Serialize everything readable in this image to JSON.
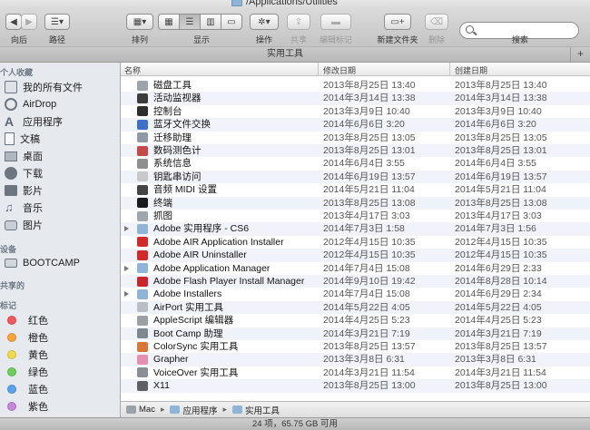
{
  "window": {
    "title": "/Applications/Utilities"
  },
  "toolbar": {
    "back_label": "向后",
    "path_label": "路径",
    "arrange_label": "排列",
    "view_label": "显示",
    "action_label": "操作",
    "share_label": "共享",
    "edit_tags_label": "编辑标记",
    "new_folder_label": "新建文件夹",
    "delete_label": "删除",
    "search_label": "搜索",
    "search_placeholder": ""
  },
  "tabbar": {
    "title": "实用工具",
    "add_glyph": "+"
  },
  "sidebar": {
    "favorites_heading": "个人收藏",
    "favorites": [
      {
        "label": "我的所有文件",
        "icon": "all-files-icon"
      },
      {
        "label": "AirDrop",
        "icon": "airdrop-icon"
      },
      {
        "label": "应用程序",
        "icon": "applications-icon"
      },
      {
        "label": "文稿",
        "icon": "documents-icon"
      },
      {
        "label": "桌面",
        "icon": "desktop-icon"
      },
      {
        "label": "下载",
        "icon": "downloads-icon"
      },
      {
        "label": "影片",
        "icon": "movies-icon"
      },
      {
        "label": "音乐",
        "icon": "music-icon"
      },
      {
        "label": "图片",
        "icon": "pictures-icon"
      }
    ],
    "devices_heading": "设备",
    "devices": [
      {
        "label": "BOOTCAMP",
        "icon": "drive-icon"
      }
    ],
    "shared_heading": "共享的",
    "tags_heading": "标记",
    "tags": [
      {
        "label": "红色",
        "color": "#f3595b"
      },
      {
        "label": "橙色",
        "color": "#f7a43c"
      },
      {
        "label": "黄色",
        "color": "#f2d94a"
      },
      {
        "label": "绿色",
        "color": "#6dce5b"
      },
      {
        "label": "蓝色",
        "color": "#5aa2f0"
      },
      {
        "label": "紫色",
        "color": "#c785dd"
      }
    ]
  },
  "list": {
    "columns": {
      "name": "名称",
      "modified": "修改日期",
      "created": "创建日期"
    },
    "rows": [
      {
        "name": "磁盘工具",
        "modified": "2013年8月25日 13:40",
        "created": "2013年8月25日 13:40",
        "folder": false,
        "color": "#9aa4ad"
      },
      {
        "name": "活动监视器",
        "modified": "2014年3月14日 13:38",
        "created": "2014年3月14日 13:38",
        "folder": false,
        "color": "#3c3c3c"
      },
      {
        "name": "控制台",
        "modified": "2013年3月9日 10:40",
        "created": "2013年3月9日 10:40",
        "folder": false,
        "color": "#2e2e2e"
      },
      {
        "name": "蓝牙文件交换",
        "modified": "2014年6月6日 3:20",
        "created": "2014年6月6日 3:20",
        "folder": false,
        "color": "#3f6fc7"
      },
      {
        "name": "迁移助理",
        "modified": "2013年8月25日 13:05",
        "created": "2013年8月25日 13:05",
        "folder": false,
        "color": "#8f9aa6"
      },
      {
        "name": "数码测色计",
        "modified": "2013年8月25日 13:01",
        "created": "2013年8月25日 13:01",
        "folder": false,
        "color": "#c44a4a"
      },
      {
        "name": "系统信息",
        "modified": "2014年6月4日 3:55",
        "created": "2014年6月4日 3:55",
        "folder": false,
        "color": "#8f8f8f"
      },
      {
        "name": "钥匙串访问",
        "modified": "2014年6月19日 13:57",
        "created": "2014年6月19日 13:57",
        "folder": false,
        "color": "#c9c9c9"
      },
      {
        "name": "音频 MIDI 设置",
        "modified": "2014年5月21日 11:04",
        "created": "2014年5月21日 11:04",
        "folder": false,
        "color": "#444444"
      },
      {
        "name": "终端",
        "modified": "2013年8月25日 13:08",
        "created": "2013年8月25日 13:08",
        "folder": false,
        "color": "#1a1a1a"
      },
      {
        "name": "抓图",
        "modified": "2013年4月17日 3:03",
        "created": "2013年4月17日 3:03",
        "folder": false,
        "color": "#9ea6ae"
      },
      {
        "name": "Adobe 实用程序 - CS6",
        "modified": "2014年7月3日 1:58",
        "created": "2014年7月3日 1:56",
        "folder": true,
        "color": "#8fb4d8"
      },
      {
        "name": "Adobe AIR Application Installer",
        "modified": "2012年4月15日 10:35",
        "created": "2012年4月15日 10:35",
        "folder": false,
        "color": "#d22a2a"
      },
      {
        "name": "Adobe AIR Uninstaller",
        "modified": "2012年4月15日 10:35",
        "created": "2012年4月15日 10:35",
        "folder": false,
        "color": "#d22a2a"
      },
      {
        "name": "Adobe Application Manager",
        "modified": "2014年7月4日 15:08",
        "created": "2014年6月29日 2:33",
        "folder": true,
        "color": "#8fb4d8"
      },
      {
        "name": "Adobe Flash Player Install Manager",
        "modified": "2014年9月10日 19:42",
        "created": "2014年8月28日 10:14",
        "folder": false,
        "color": "#c8262b"
      },
      {
        "name": "Adobe Installers",
        "modified": "2014年7月4日 15:08",
        "created": "2014年6月29日 2:34",
        "folder": true,
        "color": "#8fb4d8"
      },
      {
        "name": "AirPort 实用工具",
        "modified": "2014年5月22日 4:05",
        "created": "2014年5月22日 4:05",
        "folder": false,
        "color": "#b8bec4"
      },
      {
        "name": "AppleScript 编辑器",
        "modified": "2014年4月25日 5:23",
        "created": "2014年4月25日 5:23",
        "folder": false,
        "color": "#9aa0a6"
      },
      {
        "name": "Boot Camp 助理",
        "modified": "2014年3月21日 7:19",
        "created": "2014年3月21日 7:19",
        "folder": false,
        "color": "#7f8890"
      },
      {
        "name": "ColorSync 实用工具",
        "modified": "2013年8月25日 13:57",
        "created": "2013年8月25日 13:57",
        "folder": false,
        "color": "#d9773a"
      },
      {
        "name": "Grapher",
        "modified": "2013年3月8日 6:31",
        "created": "2013年3月8日 6:31",
        "folder": false,
        "color": "#e58fb3"
      },
      {
        "name": "VoiceOver 实用工具",
        "modified": "2014年3月21日 11:54",
        "created": "2014年3月21日 11:54",
        "folder": false,
        "color": "#8a8f95"
      },
      {
        "name": "X11",
        "modified": "2013年8月25日 13:00",
        "created": "2013年8月25日 13:00",
        "folder": false,
        "color": "#5d6166"
      }
    ]
  },
  "pathbar": [
    {
      "label": "Mac",
      "color": "#9aa3ab"
    },
    {
      "label": "应用程序",
      "color": "#8fb4d8"
    },
    {
      "label": "实用工具",
      "color": "#8fb4d8"
    }
  ],
  "status": {
    "text": "24 项，65.75 GB 可用"
  }
}
